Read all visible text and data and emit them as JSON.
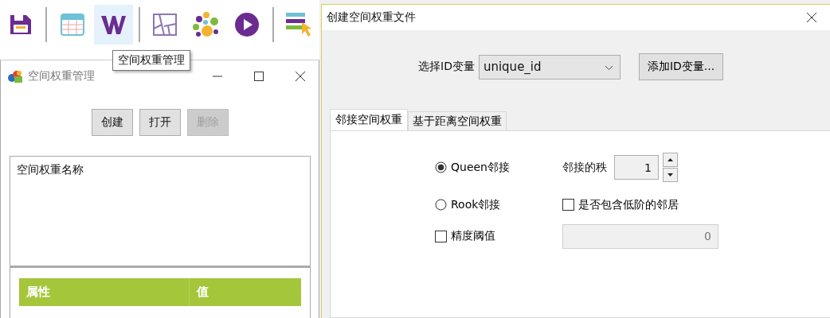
{
  "toolbar": {
    "items": [
      {
        "kind": "button",
        "selected": false
      },
      {
        "kind": "separator"
      },
      {
        "kind": "button",
        "selected": false
      },
      {
        "kind": "button",
        "selected": true
      },
      {
        "kind": "separator"
      },
      {
        "kind": "button",
        "selected": false
      },
      {
        "kind": "button",
        "selected": false
      },
      {
        "kind": "button",
        "selected": false
      },
      {
        "kind": "separator"
      },
      {
        "kind": "button",
        "selected": false
      }
    ]
  },
  "tooltip": {
    "text": "空间权重管理"
  },
  "weights_window": {
    "title": "空间权重管理",
    "buttons": [
      {
        "label": "创建",
        "disabled": false
      },
      {
        "label": "打开",
        "disabled": false
      },
      {
        "label": "删除",
        "disabled": true
      }
    ],
    "list_header": "空间权重名称",
    "table": {
      "columns": [
        "属性",
        "值"
      ]
    }
  },
  "dialog": {
    "title": "创建空间权重文件",
    "id_label": "选择ID变量",
    "id_select": "unique_id",
    "add_button": "添加ID变量...",
    "tabs": [
      {
        "label": "邻接空间权重",
        "selected": true
      },
      {
        "label": "基于距离空间权重",
        "selected": false
      }
    ],
    "radios": [
      {
        "label": "Queen邻接",
        "selected": true
      },
      {
        "label": "Rook邻接",
        "selected": false
      }
    ],
    "order_label": "邻接的秩",
    "order_value": "1",
    "lower_order": {
      "label": "是否包含低阶的邻居",
      "checked": false
    },
    "precision": {
      "label": "精度阈值",
      "checked": false,
      "value": "0",
      "disabled": true
    }
  }
}
